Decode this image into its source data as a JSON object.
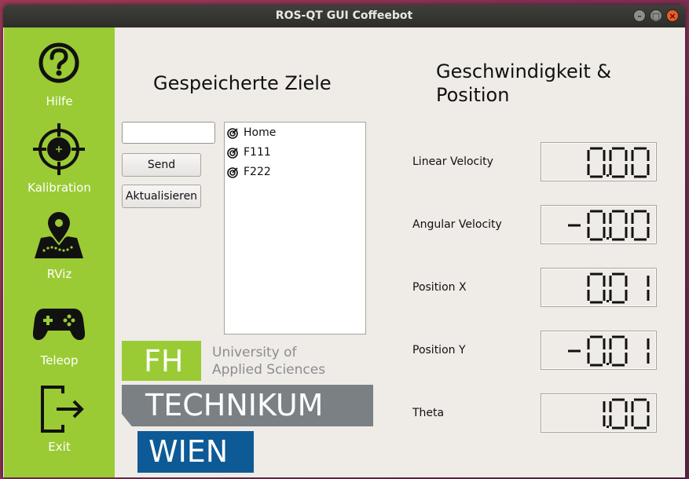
{
  "window": {
    "title": "ROS-QT GUI Coffeebot"
  },
  "sidebar": {
    "items": [
      {
        "label": "Hilfe",
        "icon": "help-icon"
      },
      {
        "label": "Kalibration",
        "icon": "crosshair-icon"
      },
      {
        "label": "RViz",
        "icon": "map-pin-icon"
      },
      {
        "label": "Teleop",
        "icon": "gamepad-icon"
      },
      {
        "label": "Exit",
        "icon": "exit-icon"
      }
    ]
  },
  "goals": {
    "heading": "Gespeicherte Ziele",
    "input_value": "",
    "send_label": "Send",
    "refresh_label": "Aktualisieren",
    "items": [
      "Home",
      "F111",
      "F222"
    ]
  },
  "logo": {
    "fh": "FH",
    "university_line1": "University of",
    "university_line2": "Applied Sciences",
    "technikum": "TECHNIKUM",
    "wien": "WIEN"
  },
  "status": {
    "heading_line1": "Geschwindigkeit &",
    "heading_line2": "Position",
    "readings": [
      {
        "label": "Linear Velocity",
        "value": "0.00"
      },
      {
        "label": "Angular Velocity",
        "value": "-0.00"
      },
      {
        "label": "Position X",
        "value": "0.01"
      },
      {
        "label": "Position Y",
        "value": "-0.01"
      },
      {
        "label": "Theta",
        "value": "1.00"
      }
    ]
  },
  "colors": {
    "sidebar": "#9acb34",
    "brand_green": "#9acb34",
    "brand_grey": "#7a8084",
    "brand_blue": "#0d5a96",
    "window_bg": "#efebe7"
  }
}
